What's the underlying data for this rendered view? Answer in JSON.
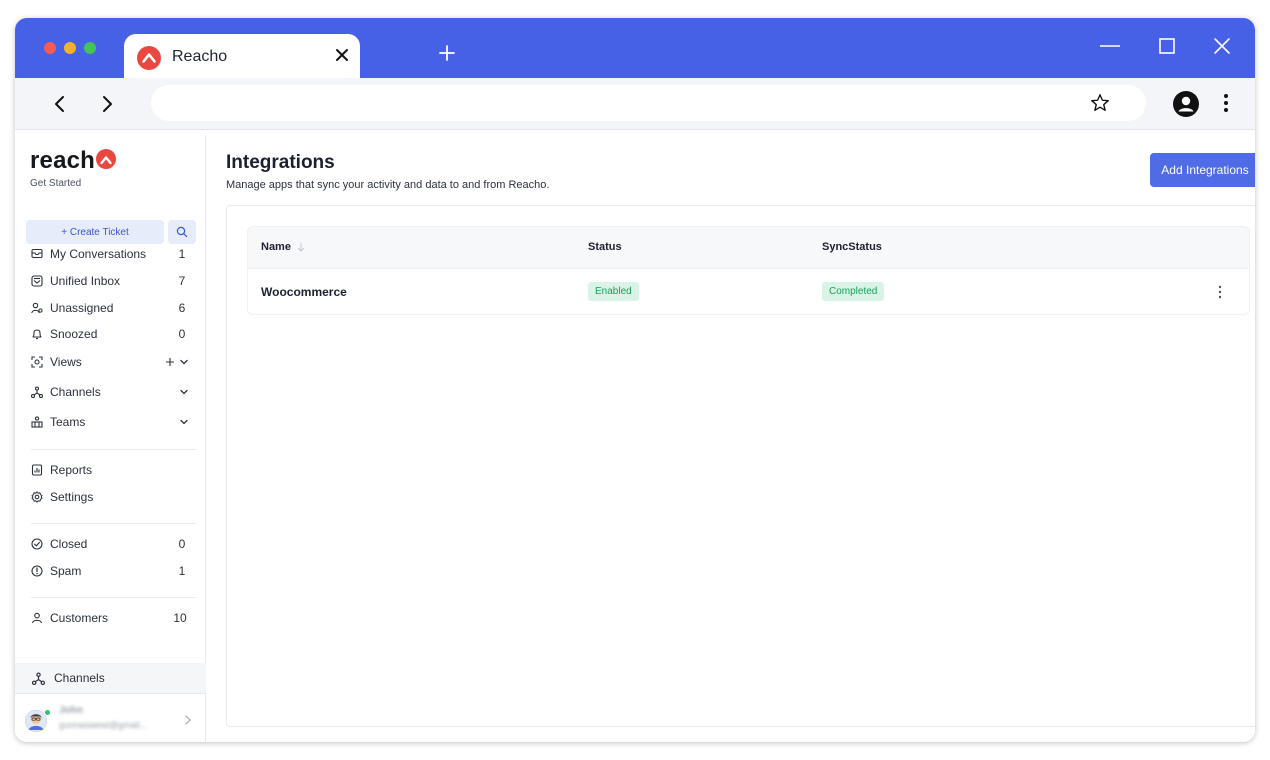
{
  "browser": {
    "tab_title": "Reacho",
    "traffic_lights": [
      "#f25c54",
      "#f5b225",
      "#44c556"
    ],
    "accent": "#4660e6"
  },
  "sidebar": {
    "brand": "reach",
    "brand_sub": "Get Started",
    "create_ticket": "+ Create Ticket",
    "primary_items": [
      {
        "label": "My Conversations",
        "count": "1",
        "icon": "conversations-icon"
      },
      {
        "label": "Unified Inbox",
        "count": "7",
        "icon": "inbox-icon"
      },
      {
        "label": "Unassigned",
        "count": "6",
        "icon": "unassigned-icon"
      },
      {
        "label": "Snoozed",
        "count": "0",
        "icon": "snooze-icon"
      },
      {
        "label": "Views",
        "icon": "views-icon"
      },
      {
        "label": "Channels",
        "icon": "channels-icon"
      },
      {
        "label": "Teams",
        "icon": "teams-icon"
      }
    ],
    "secondary_items": [
      {
        "label": "Reports",
        "icon": "reports-icon"
      },
      {
        "label": "Settings",
        "icon": "settings-icon"
      }
    ],
    "status_items": [
      {
        "label": "Closed",
        "count": "0",
        "icon": "closed-icon"
      },
      {
        "label": "Spam",
        "count": "1",
        "icon": "spam-icon"
      }
    ],
    "customers": {
      "label": "Customers",
      "count": "10"
    },
    "bottom_channels": "Channels",
    "user": {
      "name": "John",
      "email": "gunnasiaewi@gmail..."
    }
  },
  "main": {
    "title": "Integrations",
    "subtitle": "Manage apps that sync your activity and data to and from Reacho.",
    "add_button": "Add Integrations",
    "table": {
      "columns": [
        "Name",
        "Status",
        "SyncStatus"
      ],
      "rows": [
        {
          "name": "Woocommerce",
          "status": "Enabled",
          "sync_status": "Completed"
        }
      ]
    }
  }
}
